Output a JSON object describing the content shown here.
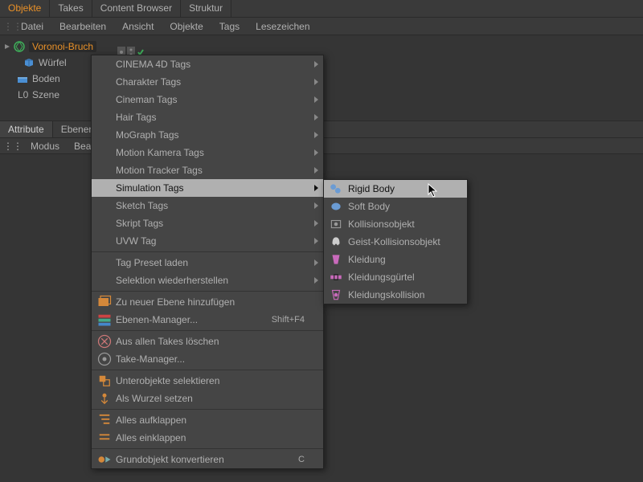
{
  "top_tabs": {
    "objekte": "Objekte",
    "takes": "Takes",
    "content_browser": "Content Browser",
    "struktur": "Struktur"
  },
  "menu": {
    "datei": "Datei",
    "bearbeiten": "Bearbeiten",
    "ansicht": "Ansicht",
    "objekte": "Objekte",
    "tags": "Tags",
    "lesezeichen": "Lesezeichen"
  },
  "tree": {
    "voronoi": "Voronoi-Bruch",
    "wuerfel": "Würfel",
    "boden": "Boden",
    "szene": "Szene"
  },
  "attr_tabs": {
    "attribute": "Attribute",
    "ebenen": "Ebenen"
  },
  "attr_menu": {
    "modus": "Modus",
    "bearbeiten": "Bearb"
  },
  "ctx": {
    "cinema4d": "CINEMA 4D Tags",
    "charakter": "Charakter Tags",
    "cineman": "Cineman Tags",
    "hair": "Hair Tags",
    "mograph": "MoGraph Tags",
    "motion_kamera": "Motion Kamera Tags",
    "motion_tracker": "Motion Tracker Tags",
    "simulation": "Simulation Tags",
    "sketch": "Sketch Tags",
    "skript": "Skript Tags",
    "uvw": "UVW Tag",
    "preset_laden": "Tag Preset laden",
    "selektion": "Selektion wiederherstellen",
    "neue_ebene": "Zu neuer Ebene hinzufügen",
    "ebenen_manager": "Ebenen-Manager...",
    "ebenen_manager_sc": "Shift+F4",
    "alle_takes": "Aus allen Takes löschen",
    "take_manager": "Take-Manager...",
    "unterobjekte": "Unterobjekte selektieren",
    "als_wurzel": "Als Wurzel setzen",
    "aufklappen": "Alles aufklappen",
    "einklappen": "Alles einklappen",
    "grundobjekt": "Grundobjekt konvertieren",
    "grundobjekt_sc": "C"
  },
  "submenu": {
    "rigid": "Rigid Body",
    "soft": "Soft Body",
    "kollisionsobjekt": "Kollisionsobjekt",
    "geist": "Geist-Kollisionsobjekt",
    "kleidung": "Kleidung",
    "kleidungsguertel": "Kleidungsgürtel",
    "kleidungskollision": "Kleidungskollision"
  },
  "colors": {
    "accent": "#e89028"
  }
}
